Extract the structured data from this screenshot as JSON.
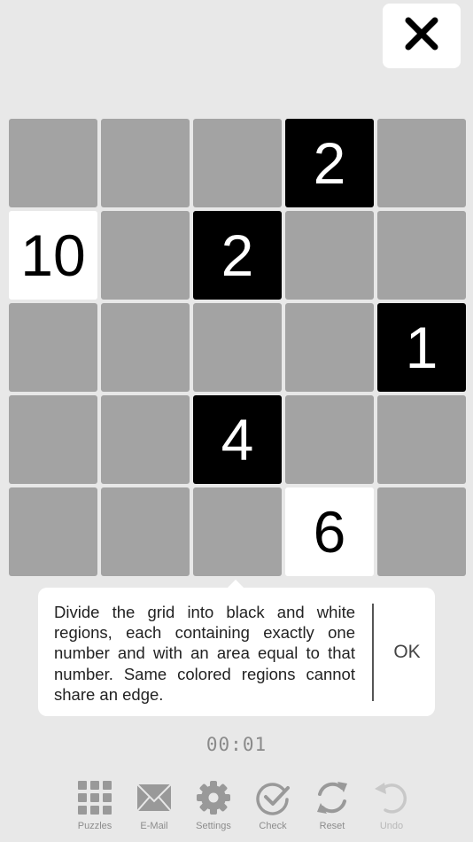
{
  "grid": {
    "rows": [
      [
        {
          "fill": "gray",
          "label": ""
        },
        {
          "fill": "gray",
          "label": ""
        },
        {
          "fill": "gray",
          "label": ""
        },
        {
          "fill": "black",
          "label": "2"
        },
        {
          "fill": "gray",
          "label": ""
        }
      ],
      [
        {
          "fill": "white",
          "label": "10"
        },
        {
          "fill": "gray",
          "label": ""
        },
        {
          "fill": "black",
          "label": "2"
        },
        {
          "fill": "gray",
          "label": ""
        },
        {
          "fill": "gray",
          "label": ""
        }
      ],
      [
        {
          "fill": "gray",
          "label": ""
        },
        {
          "fill": "gray",
          "label": ""
        },
        {
          "fill": "gray",
          "label": ""
        },
        {
          "fill": "gray",
          "label": ""
        },
        {
          "fill": "black",
          "label": "1"
        }
      ],
      [
        {
          "fill": "gray",
          "label": ""
        },
        {
          "fill": "gray",
          "label": ""
        },
        {
          "fill": "black",
          "label": "4"
        },
        {
          "fill": "gray",
          "label": ""
        },
        {
          "fill": "gray",
          "label": ""
        }
      ],
      [
        {
          "fill": "gray",
          "label": ""
        },
        {
          "fill": "gray",
          "label": ""
        },
        {
          "fill": "gray",
          "label": ""
        },
        {
          "fill": "white",
          "label": "6"
        },
        {
          "fill": "gray",
          "label": ""
        }
      ]
    ]
  },
  "tooltip": {
    "text": "Divide the grid into black and white regions, each containing exactly one number and with an area equal to that number. Same colored regions cannot share an edge.",
    "ok_label": "OK"
  },
  "timer": {
    "value": "00:01"
  },
  "toolbar": {
    "puzzles": {
      "label": "Puzzles",
      "icon": "grid-icon"
    },
    "email": {
      "label": "E-Mail",
      "icon": "envelope-icon"
    },
    "settings": {
      "label": "Settings",
      "icon": "gear-icon"
    },
    "check": {
      "label": "Check",
      "icon": "check-circle-icon"
    },
    "reset": {
      "label": "Reset",
      "icon": "refresh-icon"
    },
    "undo": {
      "label": "Undo",
      "icon": "undo-icon",
      "disabled": true
    }
  },
  "colors": {
    "background": "#e8e8e8",
    "cell_gray": "#a3a3a3",
    "cell_black": "#000000",
    "cell_white": "#ffffff",
    "icon_gray": "#999999"
  }
}
